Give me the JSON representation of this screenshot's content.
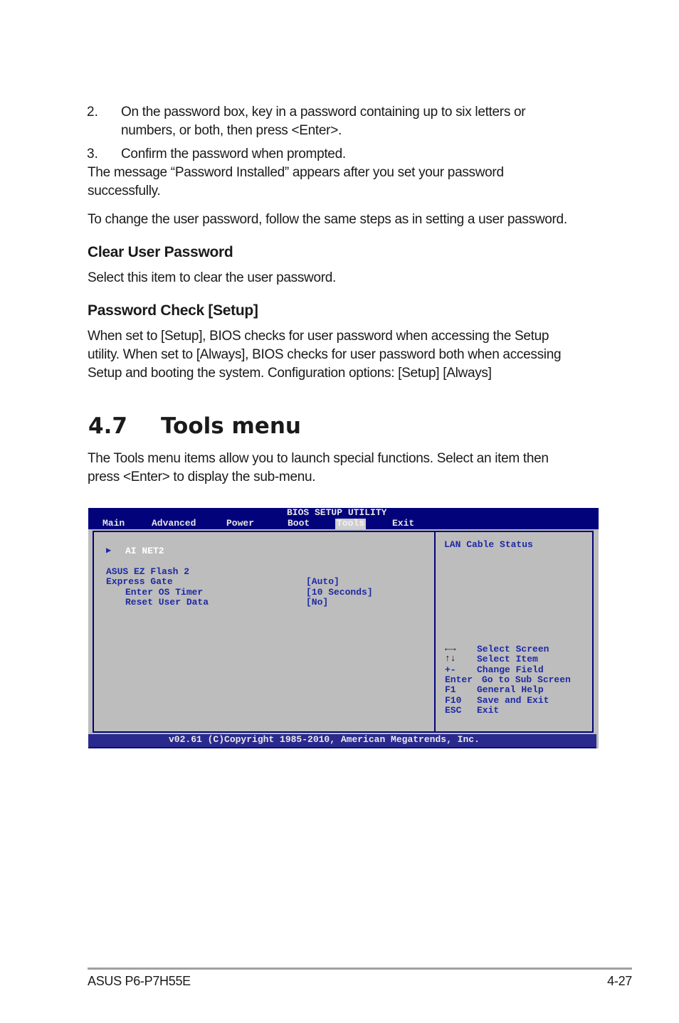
{
  "steps": [
    {
      "num": "2.",
      "lines": [
        "On the password box, key in a password containing up to six letters or",
        "numbers, or both, then press <Enter>."
      ]
    },
    {
      "num": "3.",
      "lines": [
        "Confirm the password when prompted."
      ]
    }
  ],
  "para_installed": [
    "The message “Password Installed” appears after you set your password",
    "successfully."
  ],
  "para_change": "To change the user password, follow the same steps as in setting a user password.",
  "clear_user_password": {
    "heading": "Clear User Password",
    "body": "Select this item to clear the user password."
  },
  "password_check": {
    "heading": "Password Check [Setup]",
    "lines": [
      "When set to [Setup], BIOS checks for user password when accessing the Setup",
      "utility. When set to [Always], BIOS checks for user password both when accessing",
      "Setup and booting the system. Configuration options: [Setup] [Always]"
    ]
  },
  "section": {
    "number": "4.7",
    "title": "Tools menu",
    "intro": [
      "The Tools menu items allow you to launch special functions. Select an item then",
      "press <Enter> to display the sub-menu."
    ]
  },
  "bios": {
    "title": "BIOS SETUP UTILITY",
    "tabs": [
      "Main",
      "Advanced",
      "Power",
      "Boot",
      "Tools",
      "Exit"
    ],
    "active_tab": "Tools",
    "items": [
      {
        "label": "AI NET2",
        "value": "",
        "submenu": true,
        "selected": true
      },
      {
        "label": "ASUS EZ Flash 2",
        "value": ""
      },
      {
        "label": "Express Gate",
        "value": "[Auto]"
      },
      {
        "label": "Enter OS Timer",
        "value": "[10 Seconds]"
      },
      {
        "label": "Reset User Data",
        "value": "[No]"
      }
    ],
    "help_text": "LAN Cable Status",
    "keys": [
      {
        "key": "←→",
        "desc": "Select Screen"
      },
      {
        "key": "↑↓",
        "desc": "Select Item"
      },
      {
        "key": "+-",
        "desc": "Change Field"
      },
      {
        "key": "Enter",
        "desc": "Go to Sub Screen"
      },
      {
        "key": "F1",
        "desc": "General Help"
      },
      {
        "key": "F10",
        "desc": "Save and Exit"
      },
      {
        "key": "ESC",
        "desc": "Exit"
      }
    ],
    "copyright": "v02.61 (C)Copyright 1985-2010, American Megatrends, Inc.",
    "colors": {
      "navy": "#02027a",
      "panel": "#bdbdbd",
      "text": "#1e2aa3"
    }
  },
  "footer": {
    "left": "ASUS P6-P7H55E",
    "right": "4-27"
  }
}
